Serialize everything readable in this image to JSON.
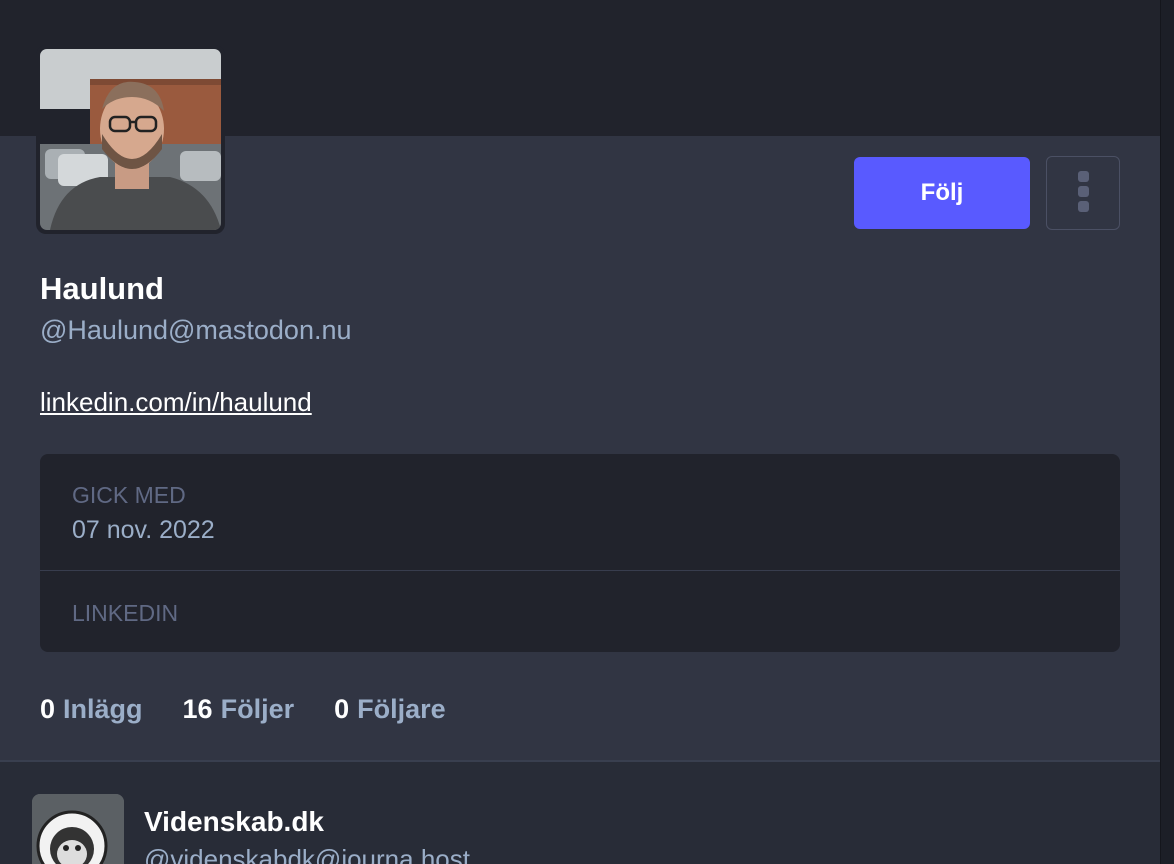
{
  "profile": {
    "display_name": "Haulund",
    "handle": "@Haulund@mastodon.nu",
    "link": "linkedin.com/in/haulund",
    "follow_label": "Följ"
  },
  "fields": [
    {
      "label": "GICK MED",
      "value": "07 nov. 2022"
    },
    {
      "label": "LINKEDIN",
      "value": ""
    }
  ],
  "stats": [
    {
      "count": "0",
      "label": "Inlägg"
    },
    {
      "count": "16",
      "label": "Följer"
    },
    {
      "count": "0",
      "label": "Följare"
    }
  ],
  "accounts": [
    {
      "name": "Videnskab.dk",
      "handle": "@videnskabdk@journa.host"
    }
  ],
  "colors": {
    "accent": "#595aff",
    "background": "#282c37",
    "panel": "#313543",
    "header": "#21232c",
    "muted_text": "#9baec8"
  }
}
